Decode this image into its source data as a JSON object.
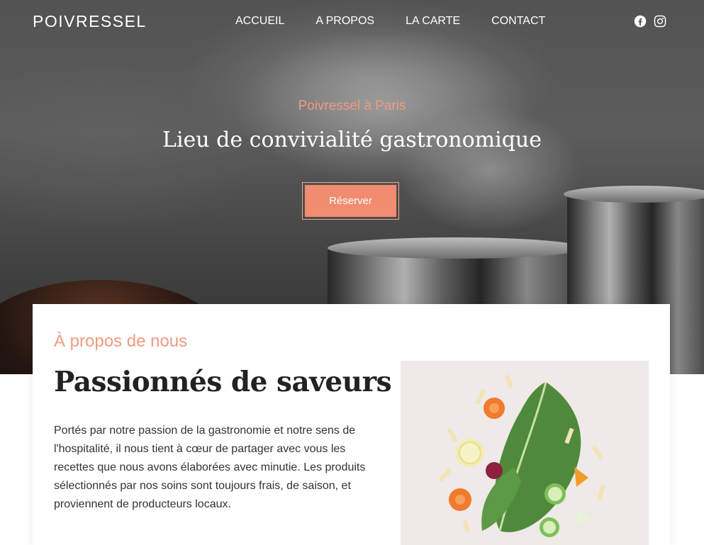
{
  "brand": "POIVRESSEL",
  "nav": [
    {
      "label": "ACCUEIL"
    },
    {
      "label": "A PROPOS"
    },
    {
      "label": "LA CARTE"
    },
    {
      "label": "CONTACT"
    }
  ],
  "social": {
    "icons": [
      "facebook-icon",
      "instagram-icon"
    ]
  },
  "hero": {
    "subtitle": "Poivressel à Paris",
    "title": "Lieu de convivialité gastronomique",
    "cta": "Réserver"
  },
  "about": {
    "kicker": "À propos de nous",
    "title": "Passionnés de saveurs",
    "text": "Portés par notre passion de la gastronomie et notre sens de l'hospitalité, il nous tient à cœur de partager avec vous les recettes que nous avons élaborées avec minutie. Les produits sélectionnés par nos soins sont toujours frais, de saison, et proviennent de producteurs locaux."
  },
  "colors": {
    "accent": "#f28c70",
    "accent_text": "#f29a80",
    "heading": "#222222"
  }
}
